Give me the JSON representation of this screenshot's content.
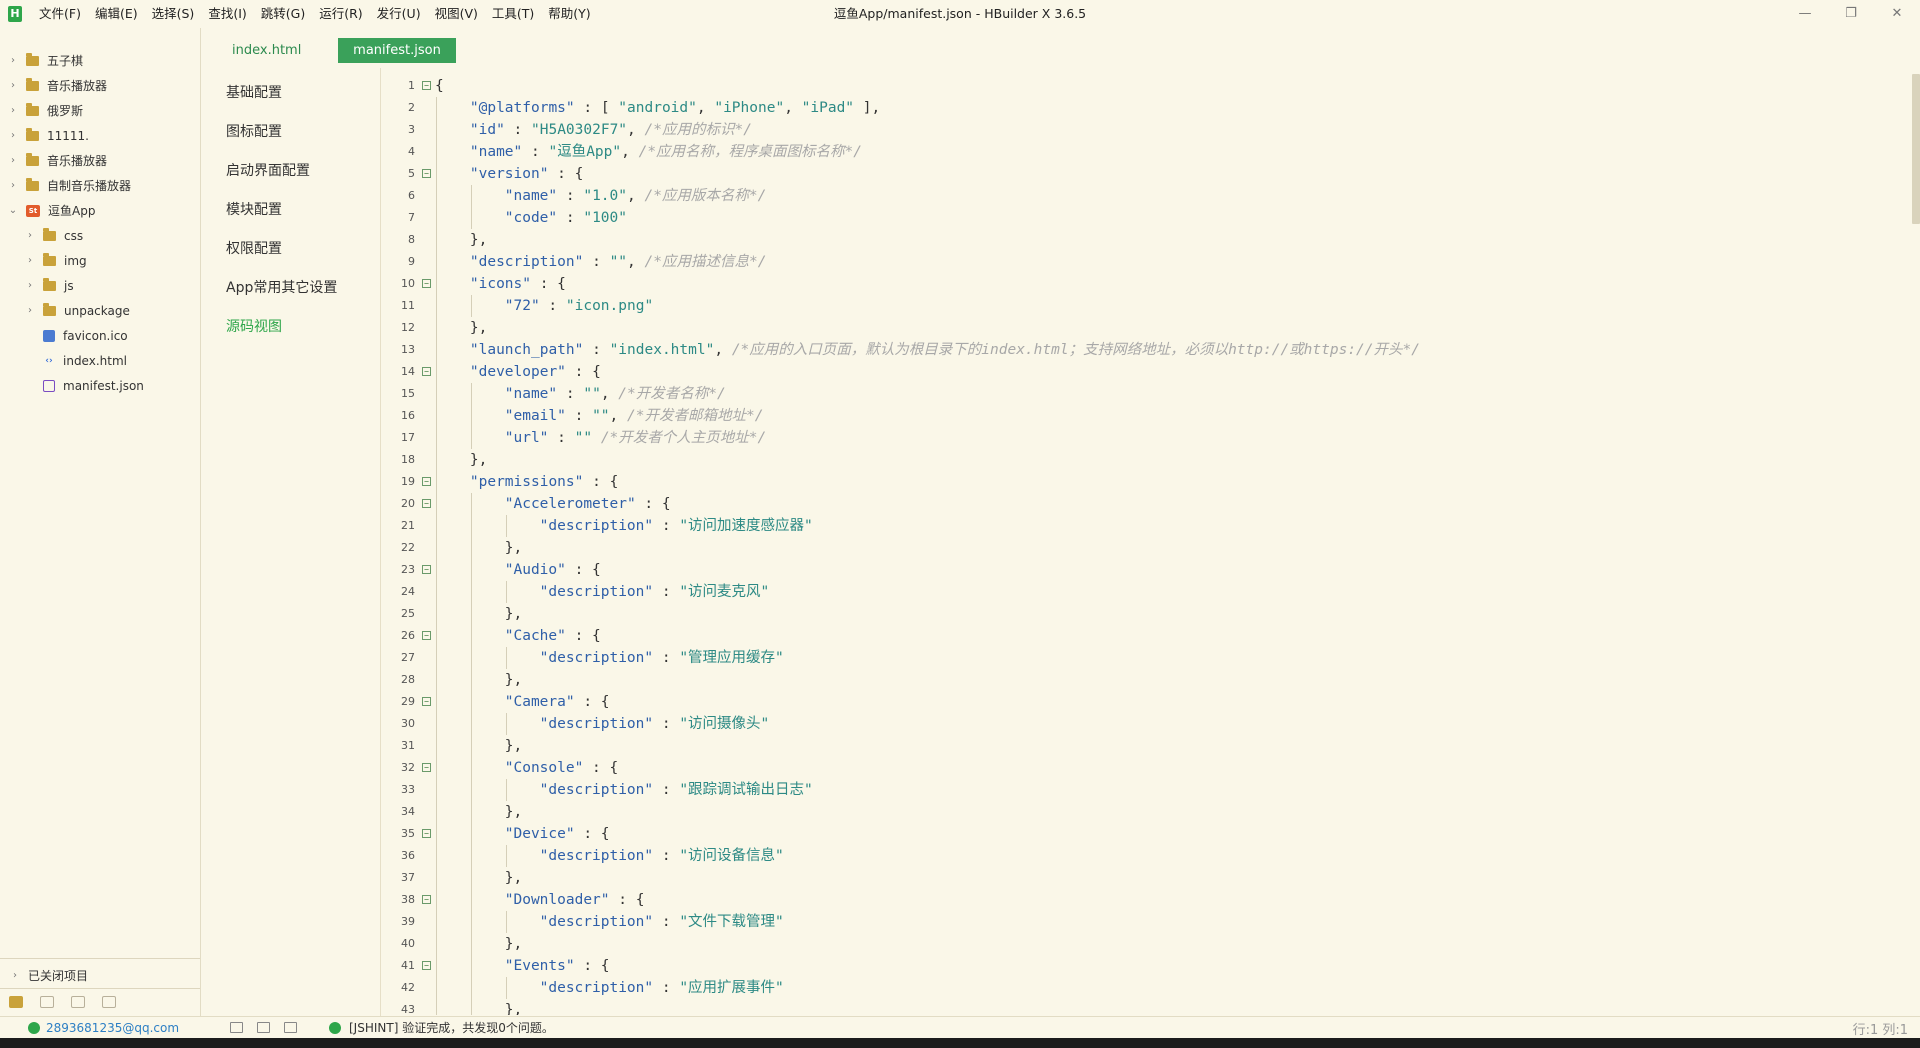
{
  "window": {
    "title": "逗鱼App/manifest.json - HBuilder X 3.6.5",
    "logo": "H",
    "menu": [
      "文件(F)",
      "编辑(E)",
      "选择(S)",
      "查找(I)",
      "跳转(G)",
      "运行(R)",
      "发行(U)",
      "视图(V)",
      "工具(T)",
      "帮助(Y)"
    ],
    "controls": {
      "minimize": "—",
      "restore": "❐",
      "close": "✕"
    }
  },
  "explorer": {
    "items": [
      {
        "label": "五子棋",
        "type": "folder",
        "chevron": "›",
        "indent": 0
      },
      {
        "label": "音乐播放器",
        "type": "folder",
        "chevron": "›",
        "indent": 0
      },
      {
        "label": "俄罗斯",
        "type": "folder",
        "chevron": "›",
        "indent": 0
      },
      {
        "label": "11111.",
        "type": "folder",
        "chevron": "›",
        "indent": 0
      },
      {
        "label": "音乐播放器",
        "type": "folder",
        "chevron": "›",
        "indent": 0
      },
      {
        "label": "自制音乐播放器",
        "type": "folder",
        "chevron": "›",
        "indent": 0
      },
      {
        "label": "逗鱼App",
        "type": "project",
        "chevron": "⌄",
        "indent": 0
      },
      {
        "label": "css",
        "type": "folder",
        "chevron": "›",
        "indent": 1
      },
      {
        "label": "img",
        "type": "folder",
        "chevron": "›",
        "indent": 1
      },
      {
        "label": "js",
        "type": "folder",
        "chevron": "›",
        "indent": 1
      },
      {
        "label": "unpackage",
        "type": "folder",
        "chevron": "›",
        "indent": 1
      },
      {
        "label": "favicon.ico",
        "type": "file-ico",
        "chevron": "",
        "indent": 1
      },
      {
        "label": "index.html",
        "type": "file-html",
        "chevron": "",
        "indent": 1
      },
      {
        "label": "manifest.json",
        "type": "file-json",
        "chevron": "",
        "indent": 1
      }
    ],
    "closed_projects": "已关闭项目"
  },
  "tabs": [
    {
      "label": "index.html",
      "active": false
    },
    {
      "label": "manifest.json",
      "active": true
    }
  ],
  "config_nav": [
    {
      "label": "基础配置",
      "active": false
    },
    {
      "label": "图标配置",
      "active": false
    },
    {
      "label": "启动界面配置",
      "active": false
    },
    {
      "label": "模块配置",
      "active": false
    },
    {
      "label": "权限配置",
      "active": false
    },
    {
      "label": "App常用其它设置",
      "active": false
    },
    {
      "label": "源码视图",
      "active": true
    }
  ],
  "colors": {
    "key": "#2f5fa8",
    "string": "#2d8a85",
    "comment": "#a8a8a8",
    "punct": "#333333",
    "accent": "#3aa15a"
  },
  "code_lines": [
    {
      "n": "1",
      "fold": true,
      "indent": 0,
      "tokens": [
        {
          "t": "{",
          "k": "p"
        }
      ]
    },
    {
      "n": "2",
      "fold": false,
      "indent": 1,
      "tokens": [
        {
          "t": "\"@platforms\"",
          "k": "key"
        },
        {
          "t": " : [ ",
          "k": "p"
        },
        {
          "t": "\"android\"",
          "k": "s"
        },
        {
          "t": ", ",
          "k": "p"
        },
        {
          "t": "\"iPhone\"",
          "k": "s"
        },
        {
          "t": ", ",
          "k": "p"
        },
        {
          "t": "\"iPad\"",
          "k": "s"
        },
        {
          "t": " ],",
          "k": "p"
        }
      ]
    },
    {
      "n": "3",
      "fold": false,
      "indent": 1,
      "tokens": [
        {
          "t": "\"id\"",
          "k": "key"
        },
        {
          "t": " : ",
          "k": "p"
        },
        {
          "t": "\"H5A0302F7\"",
          "k": "s"
        },
        {
          "t": ", ",
          "k": "p"
        },
        {
          "t": "/*应用的标识*/",
          "k": "c"
        }
      ]
    },
    {
      "n": "4",
      "fold": false,
      "indent": 1,
      "tokens": [
        {
          "t": "\"name\"",
          "k": "key"
        },
        {
          "t": " : ",
          "k": "p"
        },
        {
          "t": "\"逗鱼App\"",
          "k": "s"
        },
        {
          "t": ", ",
          "k": "p"
        },
        {
          "t": "/*应用名称，程序桌面图标名称*/",
          "k": "c"
        }
      ]
    },
    {
      "n": "5",
      "fold": true,
      "indent": 1,
      "tokens": [
        {
          "t": "\"version\"",
          "k": "key"
        },
        {
          "t": " : {",
          "k": "p"
        }
      ]
    },
    {
      "n": "6",
      "fold": false,
      "indent": 2,
      "tokens": [
        {
          "t": "\"name\"",
          "k": "key"
        },
        {
          "t": " : ",
          "k": "p"
        },
        {
          "t": "\"1.0\"",
          "k": "s"
        },
        {
          "t": ", ",
          "k": "p"
        },
        {
          "t": "/*应用版本名称*/",
          "k": "c"
        }
      ]
    },
    {
      "n": "7",
      "fold": false,
      "indent": 2,
      "tokens": [
        {
          "t": "\"code\"",
          "k": "key"
        },
        {
          "t": " : ",
          "k": "p"
        },
        {
          "t": "\"100\"",
          "k": "s"
        }
      ]
    },
    {
      "n": "8",
      "fold": false,
      "indent": 1,
      "tokens": [
        {
          "t": "},",
          "k": "p"
        }
      ]
    },
    {
      "n": "9",
      "fold": false,
      "indent": 1,
      "tokens": [
        {
          "t": "\"description\"",
          "k": "key"
        },
        {
          "t": " : ",
          "k": "p"
        },
        {
          "t": "\"\"",
          "k": "s"
        },
        {
          "t": ", ",
          "k": "p"
        },
        {
          "t": "/*应用描述信息*/",
          "k": "c"
        }
      ]
    },
    {
      "n": "10",
      "fold": true,
      "indent": 1,
      "tokens": [
        {
          "t": "\"icons\"",
          "k": "key"
        },
        {
          "t": " : {",
          "k": "p"
        }
      ]
    },
    {
      "n": "11",
      "fold": false,
      "indent": 2,
      "tokens": [
        {
          "t": "\"72\"",
          "k": "key"
        },
        {
          "t": " : ",
          "k": "p"
        },
        {
          "t": "\"icon.png\"",
          "k": "s"
        }
      ]
    },
    {
      "n": "12",
      "fold": false,
      "indent": 1,
      "tokens": [
        {
          "t": "},",
          "k": "p"
        }
      ]
    },
    {
      "n": "13",
      "fold": false,
      "indent": 1,
      "tokens": [
        {
          "t": "\"launch_path\"",
          "k": "key"
        },
        {
          "t": " : ",
          "k": "p"
        },
        {
          "t": "\"index.html\"",
          "k": "s"
        },
        {
          "t": ", ",
          "k": "p"
        },
        {
          "t": "/*应用的入口页面，默认为根目录下的index.html；支持网络地址，必须以http://或https://开头*/",
          "k": "c"
        }
      ]
    },
    {
      "n": "14",
      "fold": true,
      "indent": 1,
      "tokens": [
        {
          "t": "\"developer\"",
          "k": "key"
        },
        {
          "t": " : {",
          "k": "p"
        }
      ]
    },
    {
      "n": "15",
      "fold": false,
      "indent": 2,
      "tokens": [
        {
          "t": "\"name\"",
          "k": "key"
        },
        {
          "t": " : ",
          "k": "p"
        },
        {
          "t": "\"\"",
          "k": "s"
        },
        {
          "t": ", ",
          "k": "p"
        },
        {
          "t": "/*开发者名称*/",
          "k": "c"
        }
      ]
    },
    {
      "n": "16",
      "fold": false,
      "indent": 2,
      "tokens": [
        {
          "t": "\"email\"",
          "k": "key"
        },
        {
          "t": " : ",
          "k": "p"
        },
        {
          "t": "\"\"",
          "k": "s"
        },
        {
          "t": ", ",
          "k": "p"
        },
        {
          "t": "/*开发者邮箱地址*/",
          "k": "c"
        }
      ]
    },
    {
      "n": "17",
      "fold": false,
      "indent": 2,
      "tokens": [
        {
          "t": "\"url\"",
          "k": "key"
        },
        {
          "t": " : ",
          "k": "p"
        },
        {
          "t": "\"\"",
          "k": "s"
        },
        {
          "t": " ",
          "k": "p"
        },
        {
          "t": "/*开发者个人主页地址*/",
          "k": "c"
        }
      ]
    },
    {
      "n": "18",
      "fold": false,
      "indent": 1,
      "tokens": [
        {
          "t": "},",
          "k": "p"
        }
      ]
    },
    {
      "n": "19",
      "fold": true,
      "indent": 1,
      "tokens": [
        {
          "t": "\"permissions\"",
          "k": "key"
        },
        {
          "t": " : {",
          "k": "p"
        }
      ]
    },
    {
      "n": "20",
      "fold": true,
      "indent": 2,
      "tokens": [
        {
          "t": "\"Accelerometer\"",
          "k": "key"
        },
        {
          "t": " : {",
          "k": "p"
        }
      ]
    },
    {
      "n": "21",
      "fold": false,
      "indent": 3,
      "tokens": [
        {
          "t": "\"description\"",
          "k": "key"
        },
        {
          "t": " : ",
          "k": "p"
        },
        {
          "t": "\"访问加速度感应器\"",
          "k": "s"
        }
      ]
    },
    {
      "n": "22",
      "fold": false,
      "indent": 2,
      "tokens": [
        {
          "t": "},",
          "k": "p"
        }
      ]
    },
    {
      "n": "23",
      "fold": true,
      "indent": 2,
      "tokens": [
        {
          "t": "\"Audio\"",
          "k": "key"
        },
        {
          "t": " : {",
          "k": "p"
        }
      ]
    },
    {
      "n": "24",
      "fold": false,
      "indent": 3,
      "tokens": [
        {
          "t": "\"description\"",
          "k": "key"
        },
        {
          "t": " : ",
          "k": "p"
        },
        {
          "t": "\"访问麦克风\"",
          "k": "s"
        }
      ]
    },
    {
      "n": "25",
      "fold": false,
      "indent": 2,
      "tokens": [
        {
          "t": "},",
          "k": "p"
        }
      ]
    },
    {
      "n": "26",
      "fold": true,
      "indent": 2,
      "tokens": [
        {
          "t": "\"Cache\"",
          "k": "key"
        },
        {
          "t": " : {",
          "k": "p"
        }
      ]
    },
    {
      "n": "27",
      "fold": false,
      "indent": 3,
      "tokens": [
        {
          "t": "\"description\"",
          "k": "key"
        },
        {
          "t": " : ",
          "k": "p"
        },
        {
          "t": "\"管理应用缓存\"",
          "k": "s"
        }
      ]
    },
    {
      "n": "28",
      "fold": false,
      "indent": 2,
      "tokens": [
        {
          "t": "},",
          "k": "p"
        }
      ]
    },
    {
      "n": "29",
      "fold": true,
      "indent": 2,
      "tokens": [
        {
          "t": "\"Camera\"",
          "k": "key"
        },
        {
          "t": " : {",
          "k": "p"
        }
      ]
    },
    {
      "n": "30",
      "fold": false,
      "indent": 3,
      "tokens": [
        {
          "t": "\"description\"",
          "k": "key"
        },
        {
          "t": " : ",
          "k": "p"
        },
        {
          "t": "\"访问摄像头\"",
          "k": "s"
        }
      ]
    },
    {
      "n": "31",
      "fold": false,
      "indent": 2,
      "tokens": [
        {
          "t": "},",
          "k": "p"
        }
      ]
    },
    {
      "n": "32",
      "fold": true,
      "indent": 2,
      "tokens": [
        {
          "t": "\"Console\"",
          "k": "key"
        },
        {
          "t": " : {",
          "k": "p"
        }
      ]
    },
    {
      "n": "33",
      "fold": false,
      "indent": 3,
      "tokens": [
        {
          "t": "\"description\"",
          "k": "key"
        },
        {
          "t": " : ",
          "k": "p"
        },
        {
          "t": "\"跟踪调试输出日志\"",
          "k": "s"
        }
      ]
    },
    {
      "n": "34",
      "fold": false,
      "indent": 2,
      "tokens": [
        {
          "t": "},",
          "k": "p"
        }
      ]
    },
    {
      "n": "35",
      "fold": true,
      "indent": 2,
      "tokens": [
        {
          "t": "\"Device\"",
          "k": "key"
        },
        {
          "t": " : {",
          "k": "p"
        }
      ]
    },
    {
      "n": "36",
      "fold": false,
      "indent": 3,
      "tokens": [
        {
          "t": "\"description\"",
          "k": "key"
        },
        {
          "t": " : ",
          "k": "p"
        },
        {
          "t": "\"访问设备信息\"",
          "k": "s"
        }
      ]
    },
    {
      "n": "37",
      "fold": false,
      "indent": 2,
      "tokens": [
        {
          "t": "},",
          "k": "p"
        }
      ]
    },
    {
      "n": "38",
      "fold": true,
      "indent": 2,
      "tokens": [
        {
          "t": "\"Downloader\"",
          "k": "key"
        },
        {
          "t": " : {",
          "k": "p"
        }
      ]
    },
    {
      "n": "39",
      "fold": false,
      "indent": 3,
      "tokens": [
        {
          "t": "\"description\"",
          "k": "key"
        },
        {
          "t": " : ",
          "k": "p"
        },
        {
          "t": "\"文件下载管理\"",
          "k": "s"
        }
      ]
    },
    {
      "n": "40",
      "fold": false,
      "indent": 2,
      "tokens": [
        {
          "t": "},",
          "k": "p"
        }
      ]
    },
    {
      "n": "41",
      "fold": true,
      "indent": 2,
      "tokens": [
        {
          "t": "\"Events\"",
          "k": "key"
        },
        {
          "t": " : {",
          "k": "p"
        }
      ]
    },
    {
      "n": "42",
      "fold": false,
      "indent": 3,
      "tokens": [
        {
          "t": "\"description\"",
          "k": "key"
        },
        {
          "t": " : ",
          "k": "p"
        },
        {
          "t": "\"应用扩展事件\"",
          "k": "s"
        }
      ]
    },
    {
      "n": "43",
      "fold": false,
      "indent": 2,
      "tokens": [
        {
          "t": "},",
          "k": "p"
        }
      ]
    }
  ],
  "status": {
    "user": "2893681235@qq.com",
    "hint": "[JSHINT] 验证完成，共发现0个问题。",
    "position": "行:1 列:1"
  }
}
